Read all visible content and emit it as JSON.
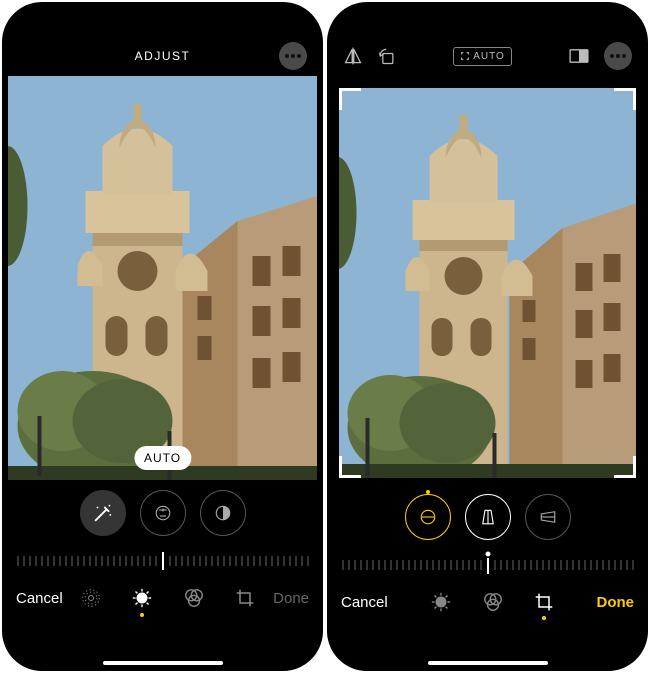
{
  "left": {
    "header_title": "ADJUST",
    "auto_badge": "AUTO",
    "cancel": "Cancel",
    "done": "Done"
  },
  "right": {
    "auto_button": "AUTO",
    "cancel": "Cancel",
    "done": "Done"
  }
}
